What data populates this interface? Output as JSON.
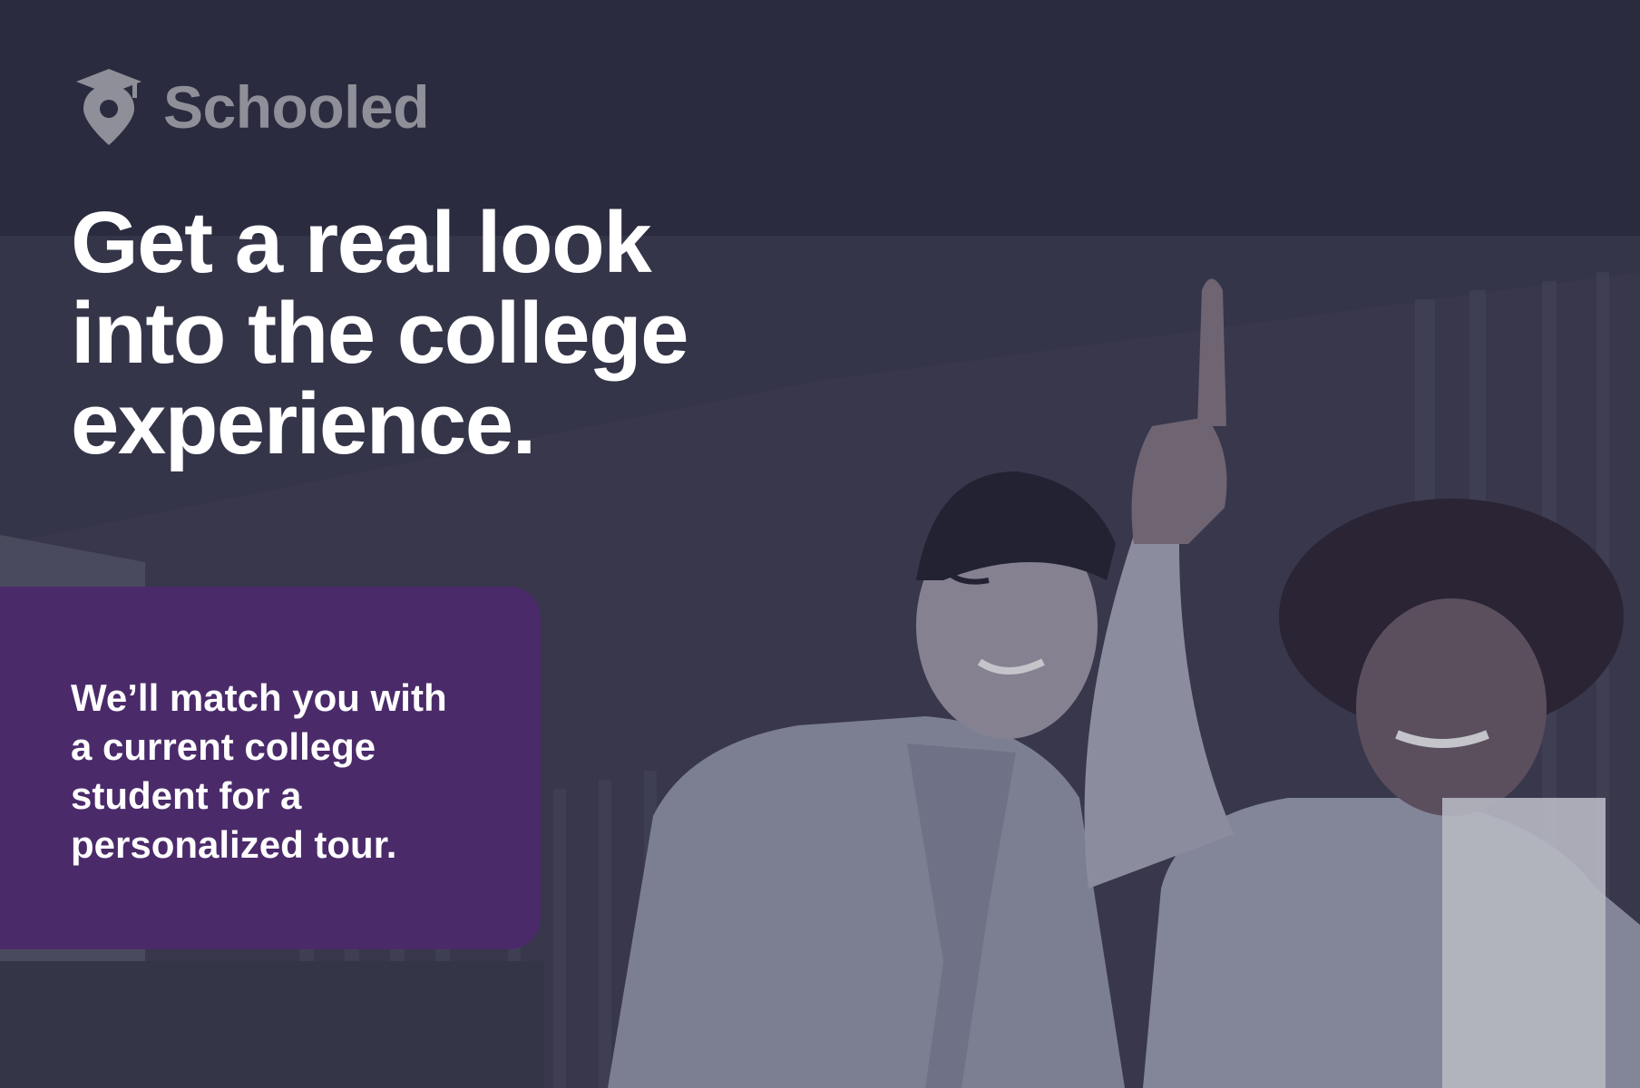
{
  "brand": {
    "name": "Schooled",
    "logo_icon": "graduation-cap-pin-icon",
    "color": "#8e8f98"
  },
  "hero": {
    "headline_lines": [
      "Get a real look",
      "into the college",
      "experience."
    ]
  },
  "callout": {
    "lines": [
      "We’ll match you with",
      "a current college",
      "student for a",
      "personalized tour."
    ],
    "background_color": "#4b2a6a"
  },
  "colors": {
    "overlay": "#2a2b3f",
    "text": "#ffffff"
  }
}
